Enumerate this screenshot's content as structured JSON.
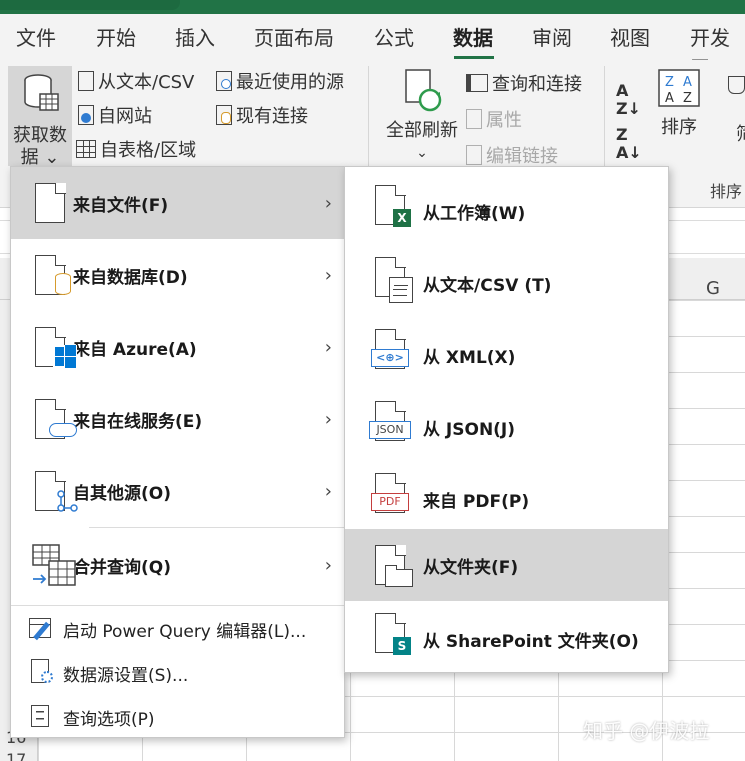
{
  "tabs": [
    "文件",
    "开始",
    "插入",
    "页面布局",
    "公式",
    "数据",
    "审阅",
    "视图",
    "开发工"
  ],
  "active_tab": "数据",
  "ribbon": {
    "get_data": {
      "line1": "获取数",
      "line2": "据 ⌄"
    },
    "from_text_csv": "从文本/CSV",
    "from_web": "自网站",
    "from_table": "自表格/区域",
    "recent_sources": "最近使用的源",
    "existing_connections": "现有连接",
    "refresh_all": {
      "line1": "全部刷新",
      "line2": "⌄"
    },
    "queries_connections": "查询和连接",
    "properties": "属性",
    "edit_links": "编辑链接",
    "sort": "排序",
    "sort_group": "排序",
    "filter_fragment": "筛"
  },
  "sheet": {
    "col_g": "G",
    "row_numbers": [
      "16",
      "17"
    ]
  },
  "menu_main": {
    "items": [
      {
        "label": "来自文件(F)",
        "icon": "file-icon",
        "highlighted": true
      },
      {
        "label": "来自数据库(D)",
        "icon": "database-icon"
      },
      {
        "label": "来自 Azure(A)",
        "icon": "azure-icon"
      },
      {
        "label": "来自在线服务(E)",
        "icon": "online-service-icon"
      },
      {
        "label": "自其他源(O)",
        "icon": "other-sources-icon"
      },
      {
        "label": "合并查询(Q)",
        "icon": "combine-queries-icon"
      }
    ],
    "footer": [
      {
        "label": "启动 Power Query 编辑器(L)...",
        "icon": "power-query-editor-icon"
      },
      {
        "label": "数据源设置(S)...",
        "icon": "data-source-settings-icon"
      },
      {
        "label": "查询选项(P)",
        "icon": "query-options-icon"
      }
    ],
    "arrow": "›"
  },
  "menu_sub": {
    "items": [
      {
        "label": "从工作簿(W)",
        "icon": "excel-workbook-icon",
        "badge": "X"
      },
      {
        "label": "从文本/CSV (T)",
        "icon": "text-csv-icon"
      },
      {
        "label": "从 XML(X)",
        "icon": "xml-icon",
        "badge": "<⊕>"
      },
      {
        "label": "从 JSON(J)",
        "icon": "json-icon",
        "badge": "JSON"
      },
      {
        "label": "来自 PDF(P)",
        "icon": "pdf-icon",
        "badge": "PDF"
      },
      {
        "label": "从文件夹(F)",
        "icon": "folder-icon",
        "highlighted": true
      },
      {
        "label": "从 SharePoint 文件夹(O)",
        "icon": "sharepoint-icon",
        "badge": "S"
      }
    ]
  },
  "watermark": "知乎 @伊波拉",
  "colors": {
    "accent": "#217346",
    "menu_highlight": "#d5d5d5",
    "excel_green": "#1e7145",
    "azure_blue": "#0078d4",
    "pdf_red": "#c43e3e",
    "sharepoint_teal": "#038387"
  }
}
